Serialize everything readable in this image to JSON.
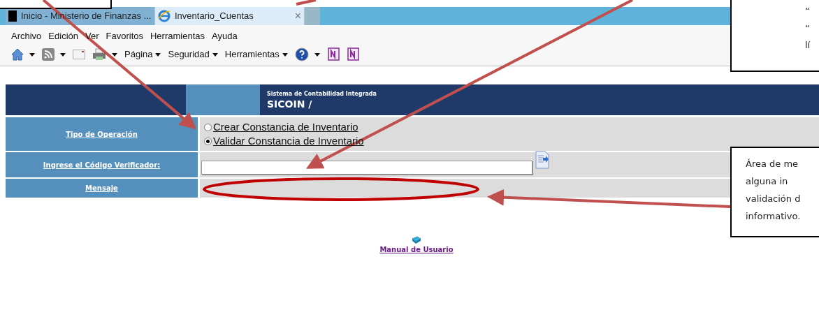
{
  "browser": {
    "tabs": [
      {
        "label": "Inicio - Ministerio de Finanzas ...",
        "selected": false,
        "kind": "page"
      },
      {
        "label": "Inventario_Cuentas",
        "selected": true,
        "kind": "ie"
      }
    ],
    "close": "×",
    "menu": [
      "Archivo",
      "Edición",
      "Ver",
      "Favoritos",
      "Herramientas",
      "Ayuda"
    ],
    "toolbar": [
      {
        "kind": "home"
      },
      {
        "kind": "feed"
      },
      {
        "kind": "mail"
      },
      {
        "kind": "print"
      },
      {
        "kind": "menu",
        "label": "Página"
      },
      {
        "kind": "menu",
        "label": "Seguridad"
      },
      {
        "kind": "menu",
        "label": "Herramientas"
      },
      {
        "kind": "help"
      },
      {
        "kind": "note"
      },
      {
        "kind": "note"
      }
    ]
  },
  "header": {
    "subtitle": "Sistema de Contabilidad Integrada",
    "title": "SICOIN /"
  },
  "form": {
    "rows": [
      {
        "label": "Tipo de Operación",
        "kind": "radios",
        "options": [
          {
            "label": "Crear Constancia de Inventario",
            "selected": false
          },
          {
            "label": "Validar Constancia de Inventario",
            "selected": true
          }
        ]
      },
      {
        "label": "Ingrese el Código Verificador:",
        "kind": "input"
      },
      {
        "label": "Mensaje",
        "kind": "message"
      }
    ]
  },
  "manual_link": "Manual de Usuario",
  "callouts": [
    {
      "lines": [
        "“",
        "“",
        "lí"
      ]
    },
    {
      "lines": [
        "Área de me",
        "alguna in",
        "validación d",
        "informativo."
      ]
    }
  ]
}
